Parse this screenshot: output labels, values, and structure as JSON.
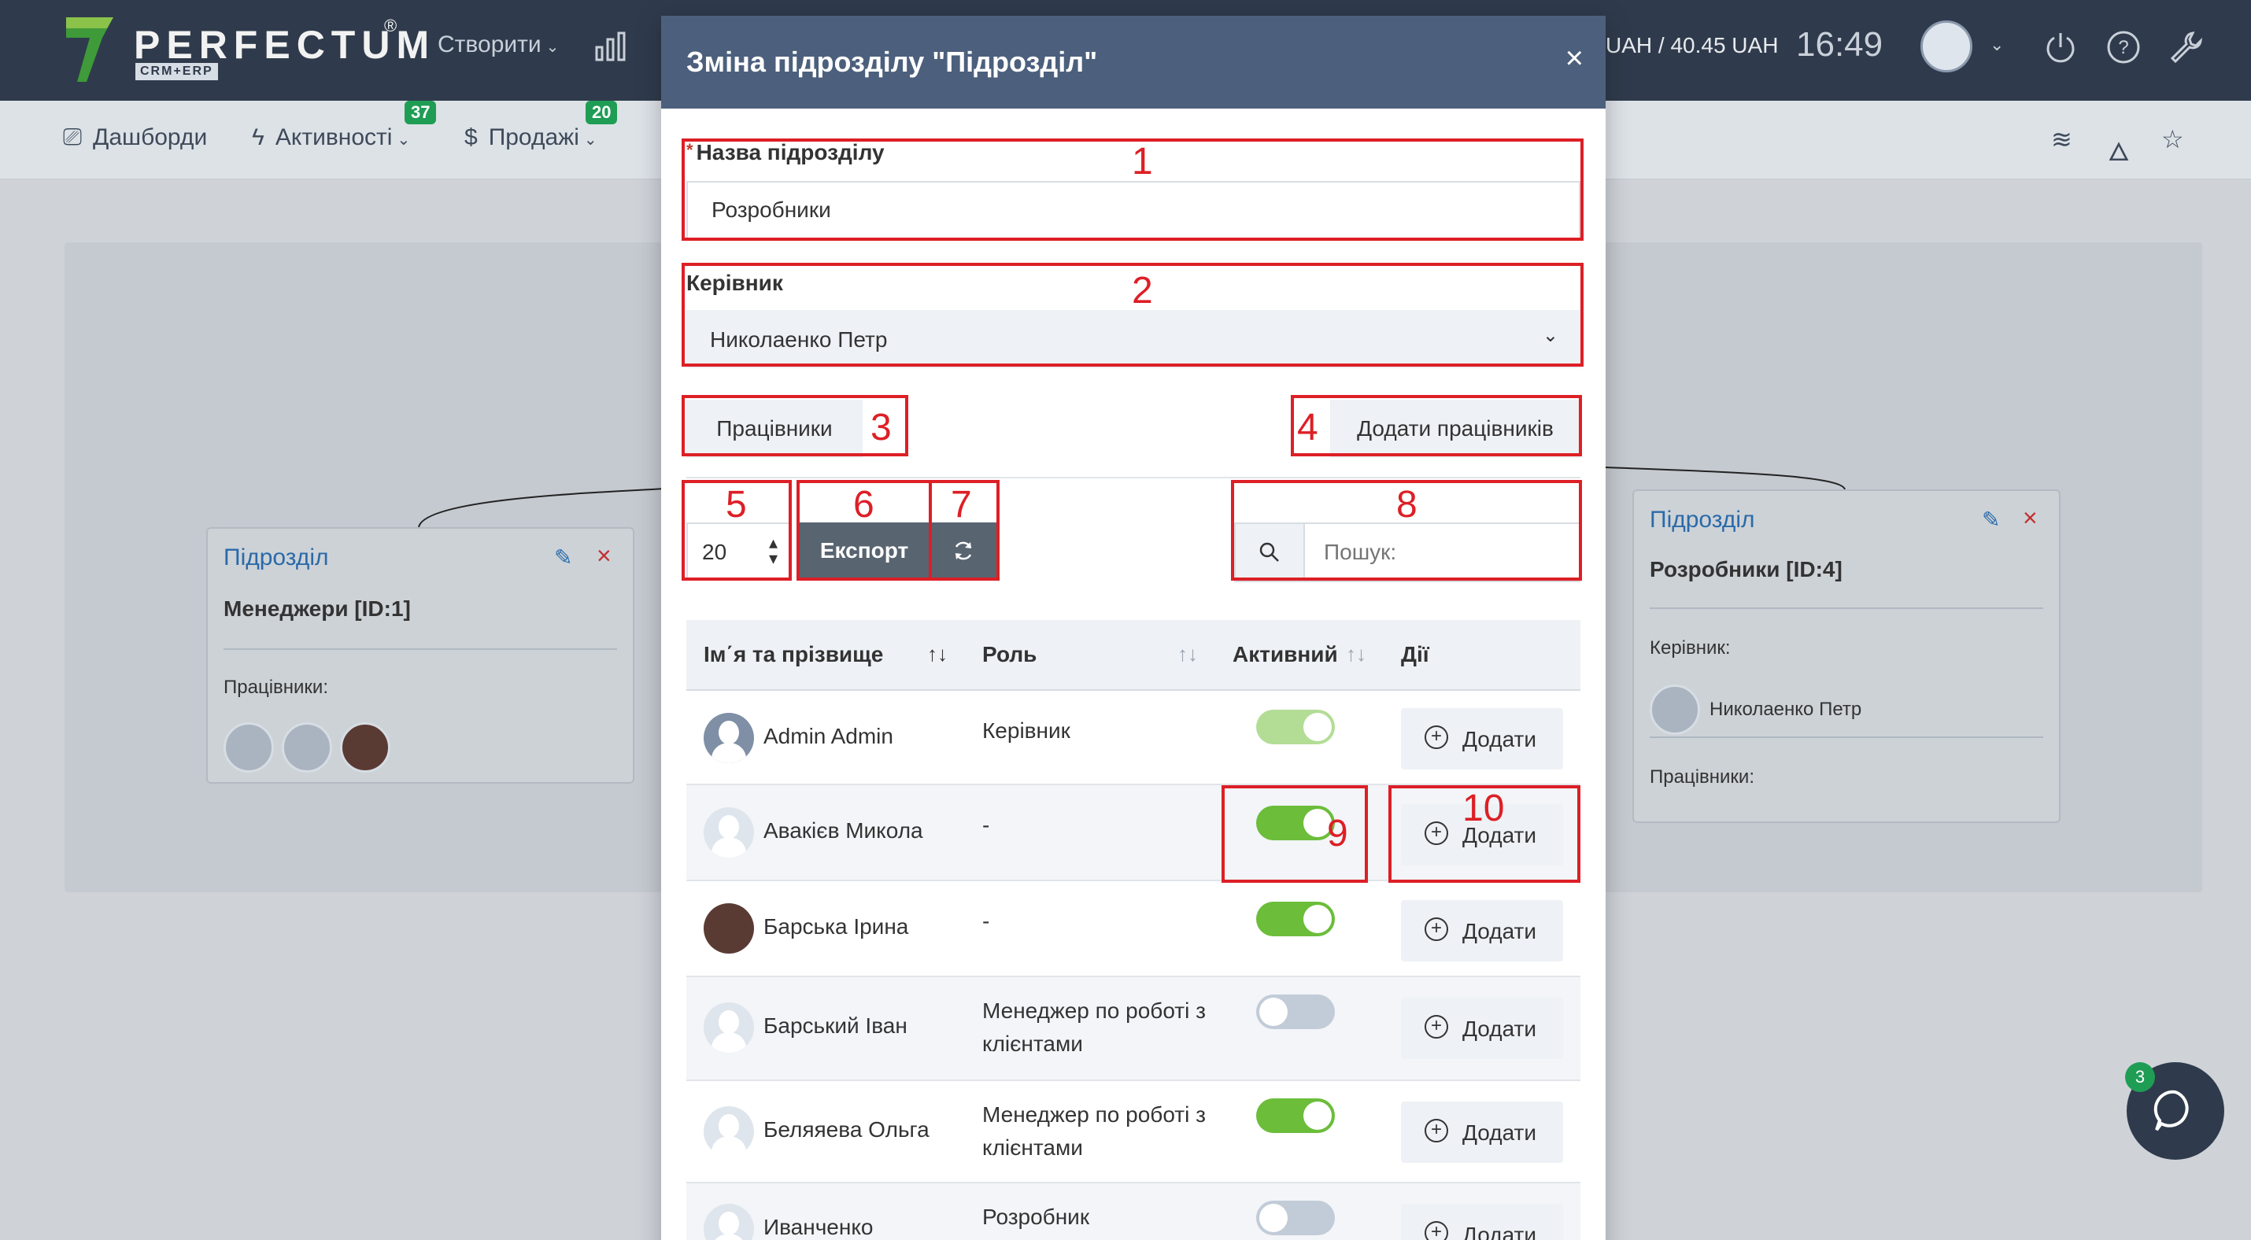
{
  "app": {
    "logo_text": "PERFECTUM",
    "logo_sub": "CRM+ERP",
    "logo_reg": "®",
    "create_label": "Створити",
    "currency": "UAH / 40.45 UAH",
    "time": "16:49"
  },
  "nav": {
    "items": [
      {
        "label": "Дашборди",
        "icon": "monitor-icon"
      },
      {
        "label": "Активності",
        "icon": "lightning-icon",
        "badge": "37"
      },
      {
        "label": "Продажі",
        "icon": "dollar-icon",
        "badge": "20"
      }
    ],
    "right_icons": [
      "layers-icon",
      "fire-icon",
      "star-icon"
    ]
  },
  "background": {
    "cards": [
      {
        "title": "Підрозділ",
        "name": "Менеджери [ID:1]",
        "employees_label": "Працівники:"
      },
      {
        "title": "Підрозділ",
        "name": "Розробники [ID:4]",
        "manager_label": "Керівник:",
        "manager_name": "Николаенко Петр",
        "employees_label": "Працівники:"
      }
    ]
  },
  "modal": {
    "title": "Зміна підрозділу \"Підрозділ\"",
    "close": "×",
    "name_label": "Назва підрозділу",
    "name_required": "*",
    "name_value": "Розробники",
    "manager_label": "Керівник",
    "manager_value": "Николаенко Петр",
    "employees_btn": "Працівники",
    "add_employees_btn": "Додати працівників",
    "per_page": "20",
    "export_btn": "Експорт",
    "search_placeholder": "Пошук:",
    "table": {
      "headers": [
        "Ім΄я та прізвище",
        "Роль",
        "Активний",
        "Дії"
      ],
      "rows": [
        {
          "name": "Admin Admin",
          "role": "Керівник",
          "active": true,
          "action": "Додати"
        },
        {
          "name": "Авакієв Микола",
          "role": "-",
          "active": true,
          "action": "Додати"
        },
        {
          "name": "Барська Ірина",
          "role": "-",
          "active": true,
          "action": "Додати"
        },
        {
          "name": "Барський Іван",
          "role": "Менеджер по роботі з клієнтами",
          "active": false,
          "action": "Додати"
        },
        {
          "name": "Беляяева Ольга",
          "role": "Менеджер по роботі з клієнтами",
          "active": true,
          "action": "Додати"
        },
        {
          "name": "Иванченко",
          "role": "Розробник",
          "active": false,
          "action": "Додати"
        }
      ]
    }
  },
  "annotations": [
    "1",
    "2",
    "3",
    "4",
    "5",
    "6",
    "7",
    "8",
    "9",
    "10"
  ],
  "chat": {
    "badge": "3"
  },
  "colors": {
    "annotation": "#dd1f26",
    "toggle_on": "#6bbd3a",
    "header": "#4c607d",
    "topbar": "#2f3b4c"
  }
}
